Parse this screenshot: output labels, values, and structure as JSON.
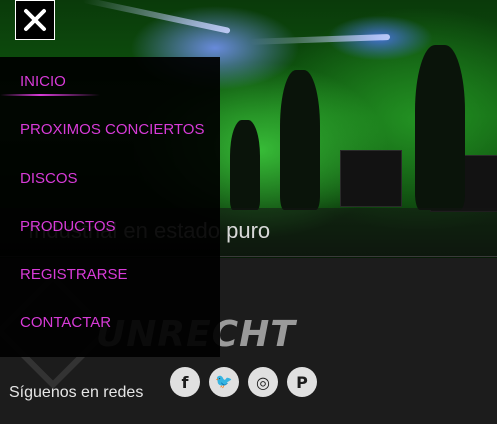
{
  "hero": {
    "tagline": "Industrial en estado puro"
  },
  "brand": {
    "logo_text": "UNRECHT"
  },
  "menu": {
    "close_icon": "close-icon",
    "items": [
      {
        "label": "INICIO",
        "active": true
      },
      {
        "label": "PROXIMOS CONCIERTOS",
        "active": false
      },
      {
        "label": "DISCOS",
        "active": false
      },
      {
        "label": "PRODUCTOS",
        "active": false
      },
      {
        "label": "REGISTRARSE",
        "active": false
      },
      {
        "label": "CONTACTAR",
        "active": false
      }
    ],
    "accent_color": "#d83bd8"
  },
  "footer": {
    "social_label": "Síguenos en redes",
    "social": [
      {
        "name": "facebook-icon",
        "glyph": "f"
      },
      {
        "name": "twitter-icon",
        "glyph": "🐦"
      },
      {
        "name": "instagram-icon",
        "glyph": "◎"
      },
      {
        "name": "pinterest-icon",
        "glyph": "P"
      }
    ]
  }
}
